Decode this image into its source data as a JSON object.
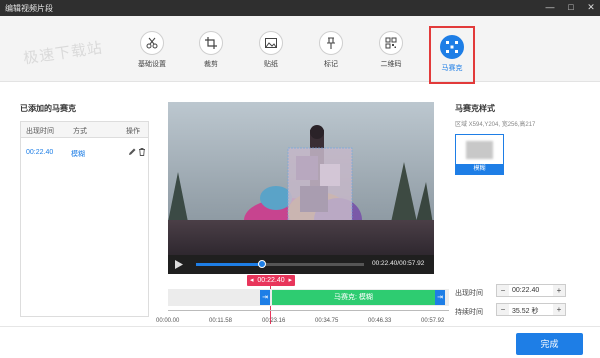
{
  "window": {
    "title": "编辑视频片段",
    "minimize": "—",
    "maximize": "□",
    "close": "✕"
  },
  "watermark": "极速下载站",
  "toolbar": {
    "items": [
      {
        "label": "基础设置",
        "icon": "scissors-icon"
      },
      {
        "label": "裁剪",
        "icon": "crop-icon"
      },
      {
        "label": "贴纸",
        "icon": "image-icon"
      },
      {
        "label": "标记",
        "icon": "pin-icon"
      },
      {
        "label": "二维码",
        "icon": "qrcode-icon"
      },
      {
        "label": "马赛克",
        "icon": "mosaic-icon",
        "active": true
      }
    ]
  },
  "left_panel": {
    "title": "已添加的马赛克",
    "columns": [
      "出现时间",
      "方式",
      "操作"
    ],
    "rows": [
      {
        "time": "00:22.40",
        "mode": "模糊"
      }
    ]
  },
  "player": {
    "time_display": "00:22.40/00:57.92",
    "marker_time": "00:22.40",
    "progress": 0.39
  },
  "timeline": {
    "mosaic_bar_label": "马赛克: 模糊",
    "ticks": [
      "00:00.00",
      "00:11.58",
      "00:23.16",
      "00:34.75",
      "00:46.33",
      "00:57.92"
    ]
  },
  "right_panel": {
    "title": "马赛克样式",
    "region": "区域 X594,Y204, 宽256,高217",
    "style_label": "模糊",
    "appear_label": "出现时间",
    "appear_value": "00:22.40",
    "duration_label": "持续时间",
    "duration_value": "35.52 秒"
  },
  "footer": {
    "done_label": "完成"
  },
  "colors": {
    "accent": "#1e7ee6",
    "mosaic_bar": "#2ecc71",
    "marker": "#e8355b",
    "highlight_border": "#e23a3a"
  }
}
